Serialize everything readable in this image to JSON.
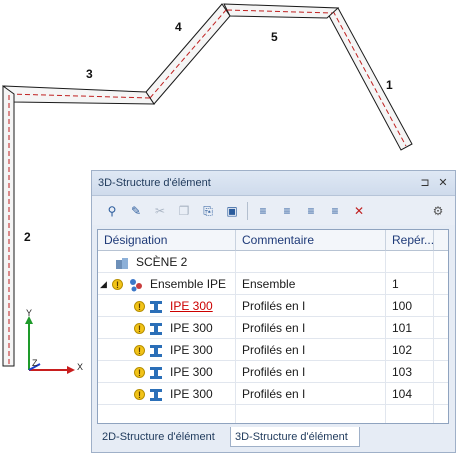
{
  "viewport": {
    "beam_labels": [
      "1",
      "2",
      "3",
      "4",
      "5"
    ],
    "axes": {
      "x": "X",
      "y": "Y",
      "z": "Z"
    }
  },
  "panel": {
    "title": "3D-Structure d'élément",
    "pin_glyph": "⊐",
    "close_glyph": "✕",
    "toolbar_icons": [
      "eyedropper-icon",
      "tools-icon",
      "cut-icon",
      "copy-icon",
      "paste-icon",
      "clipboard-icon",
      "attr-1-icon",
      "attr-2-icon",
      "attr-3-icon",
      "attr-4-icon",
      "delete-attr-icon",
      "settings-gear-icon"
    ],
    "columns": [
      "Désignation",
      "Commentaire",
      "Repér..."
    ],
    "rows": [
      {
        "designation": "SCÈNE 2",
        "commentaire": "",
        "repere": ""
      },
      {
        "designation": "Ensemble IPE",
        "commentaire": "Ensemble",
        "repere": "1"
      },
      {
        "designation": "IPE 300",
        "commentaire": "Profilés en I",
        "repere": "100"
      },
      {
        "designation": "IPE 300",
        "commentaire": "Profilés en I",
        "repere": "101"
      },
      {
        "designation": "IPE 300",
        "commentaire": "Profilés en I",
        "repere": "102"
      },
      {
        "designation": "IPE 300",
        "commentaire": "Profilés en I",
        "repere": "103"
      },
      {
        "designation": "IPE 300",
        "commentaire": "Profilés en I",
        "repere": "104"
      }
    ],
    "tabs": [
      "2D-Structure d'élément",
      "3D-Structure d'élément"
    ],
    "active_tab": "3D-Structure d'élément"
  },
  "colors": {
    "beam_edge": "#1a1a1a",
    "beam_centerline": "#c02020",
    "axis_x": "#c81e1e",
    "axis_y": "#1e9a2a",
    "axis_z": "#1e3ec8",
    "link_red": "#cc0000"
  }
}
